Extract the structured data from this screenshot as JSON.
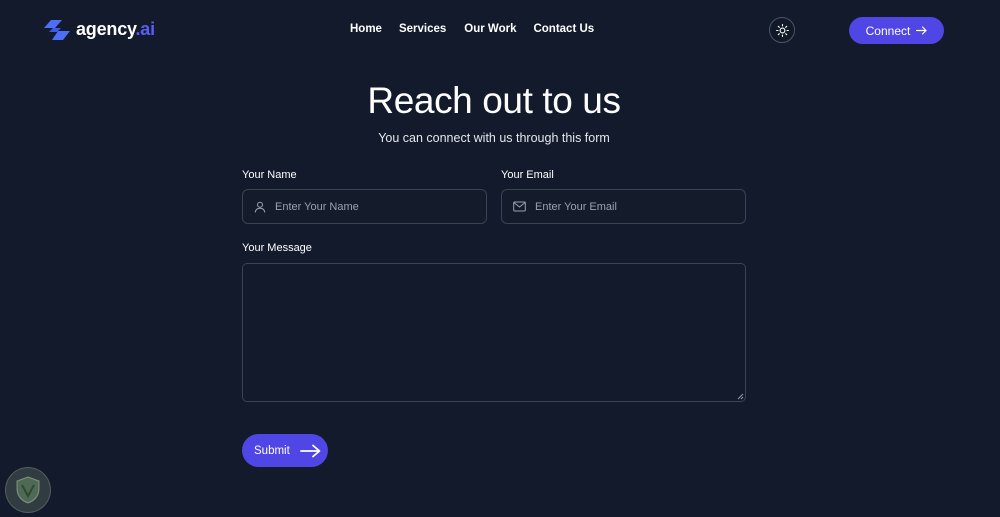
{
  "header": {
    "logo": {
      "name": "agency",
      "suffix": ".ai"
    },
    "nav": [
      "Home",
      "Services",
      "Our Work",
      "Contact Us"
    ],
    "theme_icon": "sun-icon",
    "connect_label": "Connect"
  },
  "hero": {
    "title": "Reach out to us",
    "subtitle": "You can connect with us through this form"
  },
  "form": {
    "name_label": "Your Name",
    "name_placeholder": "Enter Your Name",
    "email_label": "Your Email",
    "email_placeholder": "Enter Your Email",
    "message_label": "Your Message",
    "message_value": "",
    "submit_label": "Submit"
  },
  "colors": {
    "background": "#121a2b",
    "accent": "#4f46e5",
    "border": "#3a4352"
  }
}
